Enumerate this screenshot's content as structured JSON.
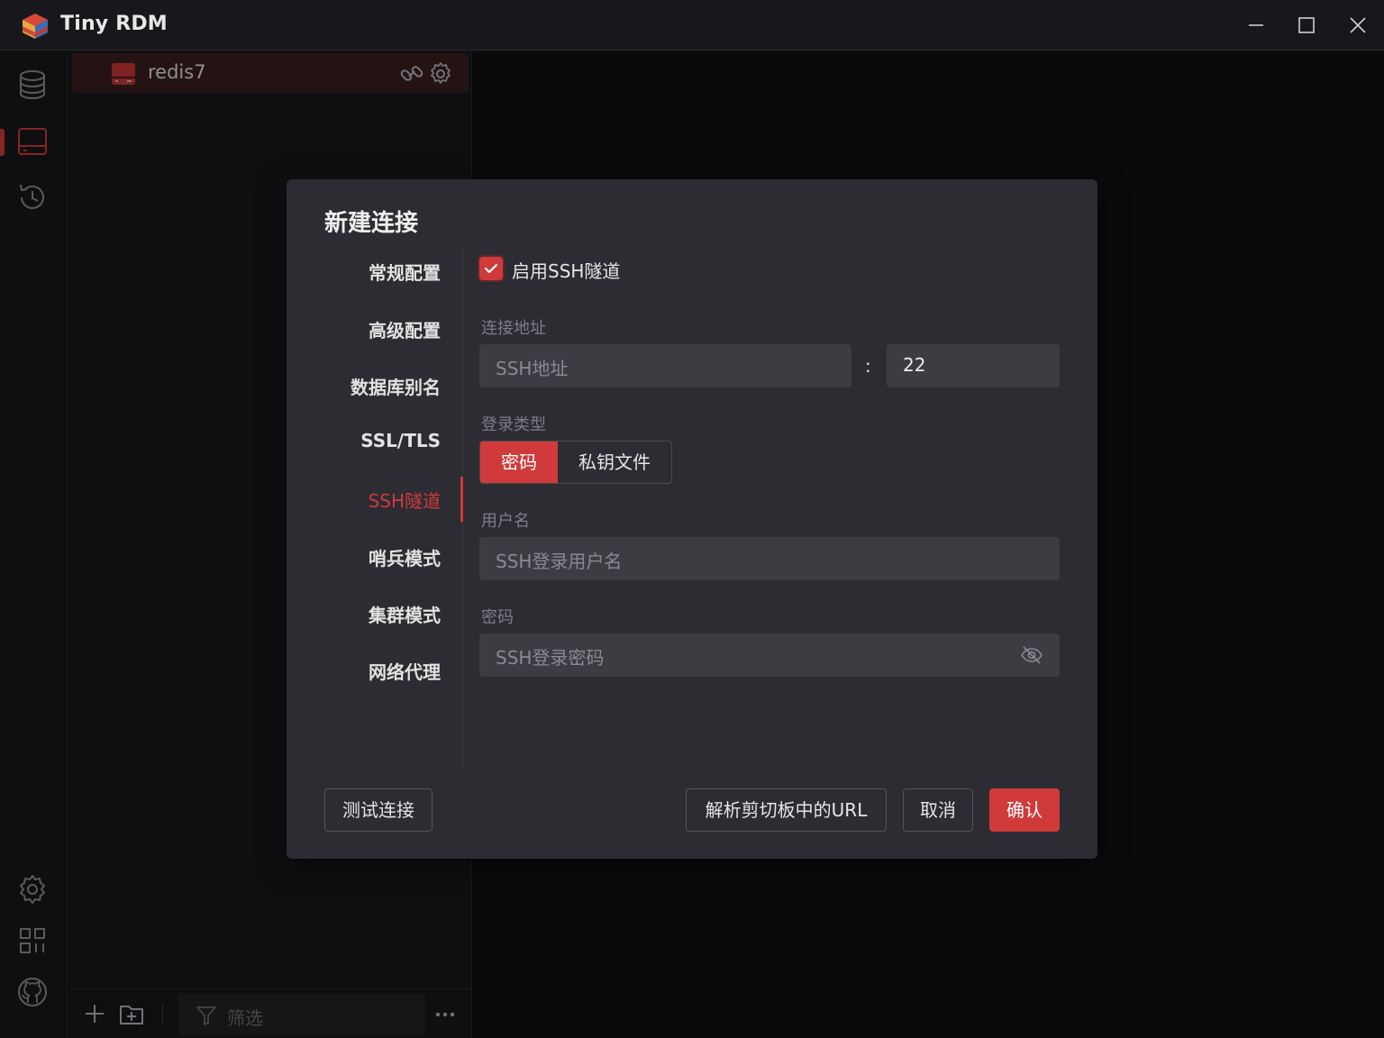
{
  "app": {
    "title": "Tiny RDM"
  },
  "connections": [
    {
      "name": "redis7"
    }
  ],
  "filter": {
    "placeholder": "筛选"
  },
  "dialog": {
    "title": "新建连接",
    "tabs": [
      {
        "label": "常规配置"
      },
      {
        "label": "高级配置"
      },
      {
        "label": "数据库别名"
      },
      {
        "label": "SSL/TLS"
      },
      {
        "label": "SSH隧道",
        "active": true
      },
      {
        "label": "哨兵模式"
      },
      {
        "label": "集群模式"
      },
      {
        "label": "网络代理"
      }
    ],
    "ssh": {
      "enable_label": "启用SSH隧道",
      "enabled": true,
      "address_label": "连接地址",
      "address_placeholder": "SSH地址",
      "colon": ":",
      "port_value": "22",
      "login_type_label": "登录类型",
      "login_types": [
        "密码",
        "私钥文件"
      ],
      "login_type_selected": "密码",
      "username_label": "用户名",
      "username_placeholder": "SSH登录用户名",
      "password_label": "密码",
      "password_placeholder": "SSH登录密码"
    },
    "buttons": {
      "test": "测试连接",
      "parse_url": "解析剪切板中的URL",
      "cancel": "取消",
      "confirm": "确认"
    }
  },
  "colors": {
    "accent": "#d03a3a",
    "background": "#101014",
    "panel": "#18181c",
    "dialog": "#2c2c32",
    "input": "#3c3c42"
  }
}
